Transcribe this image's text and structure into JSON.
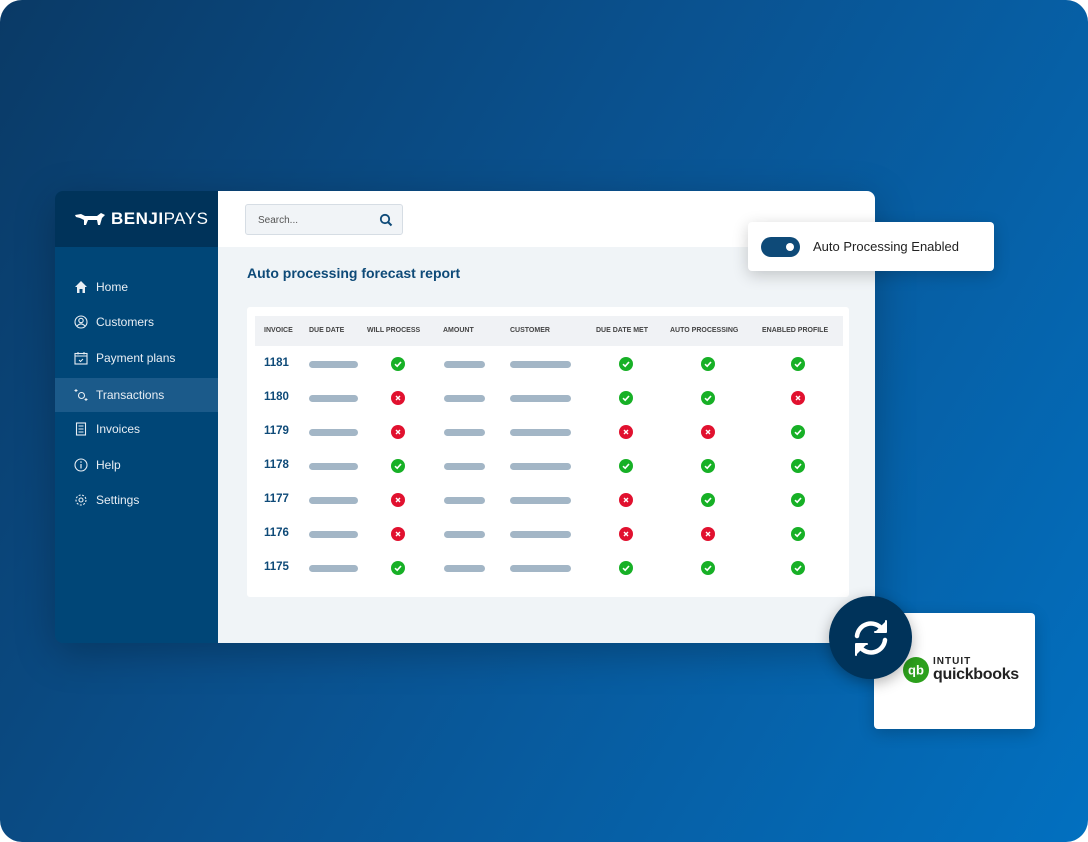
{
  "brand": {
    "name_bold": "BENJI",
    "name_light": "PAYS"
  },
  "sidebar": {
    "items": [
      {
        "label": "Home",
        "icon": "home-icon"
      },
      {
        "label": "Customers",
        "icon": "user-circle-icon"
      },
      {
        "label": "Payment plans",
        "icon": "calendar-check-icon"
      },
      {
        "label": "Transactions",
        "icon": "transactions-icon",
        "active": true
      },
      {
        "label": "Invoices",
        "icon": "receipt-icon"
      },
      {
        "label": "Help",
        "icon": "info-icon"
      },
      {
        "label": "Settings",
        "icon": "gear-icon"
      }
    ]
  },
  "search": {
    "placeholder": "Search..."
  },
  "report": {
    "title": "Auto processing forecast report",
    "columns": [
      "INVOICE",
      "DUE DATE",
      "WILL PROCESS",
      "AMOUNT",
      "CUSTOMER",
      "DUE DATE MET",
      "AUTO PROCESSING",
      "ENABLED PROFILE"
    ],
    "rows": [
      {
        "invoice": "1181",
        "will_process": true,
        "due_date_met": true,
        "auto_processing": true,
        "enabled_profile": true
      },
      {
        "invoice": "1180",
        "will_process": false,
        "due_date_met": true,
        "auto_processing": true,
        "enabled_profile": false
      },
      {
        "invoice": "1179",
        "will_process": false,
        "due_date_met": false,
        "auto_processing": false,
        "enabled_profile": true
      },
      {
        "invoice": "1178",
        "will_process": true,
        "due_date_met": true,
        "auto_processing": true,
        "enabled_profile": true
      },
      {
        "invoice": "1177",
        "will_process": false,
        "due_date_met": false,
        "auto_processing": true,
        "enabled_profile": true
      },
      {
        "invoice": "1176",
        "will_process": false,
        "due_date_met": false,
        "auto_processing": false,
        "enabled_profile": true
      },
      {
        "invoice": "1175",
        "will_process": true,
        "due_date_met": true,
        "auto_processing": true,
        "enabled_profile": true
      }
    ]
  },
  "toggle": {
    "label": "Auto Processing Enabled",
    "on": true
  },
  "integration": {
    "brand_top": "INTUIT",
    "brand_bottom": "quickbooks"
  },
  "colors": {
    "ok": "#17b026",
    "error": "#e1112f",
    "primary": "#0e4a78",
    "sidebar": "#004677"
  }
}
